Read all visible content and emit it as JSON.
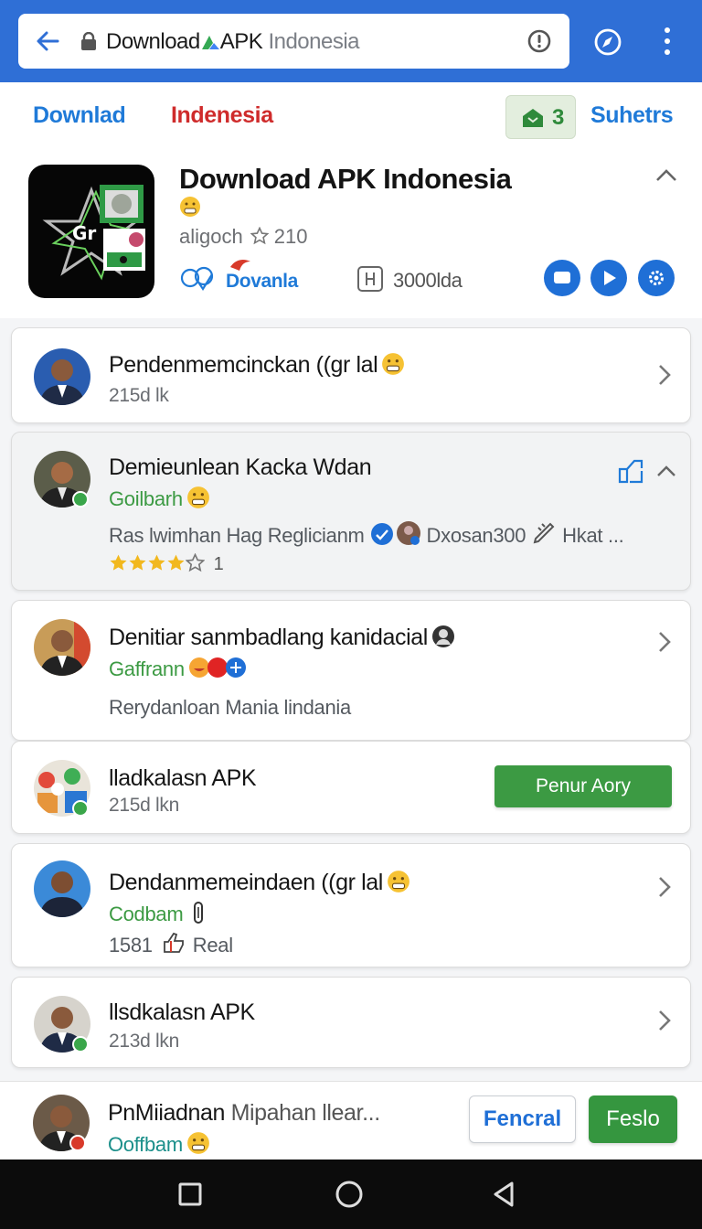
{
  "browser": {
    "url_brand": "Download",
    "url_brand_suffix": "APK",
    "url_rest": "Indonesia"
  },
  "header": {
    "download_link": "Downlad",
    "region_link": "Indenesia",
    "badge_count": "3",
    "subscribers_link": "Suhetrs"
  },
  "app": {
    "title": "Download APK Indonesia",
    "developer": "aligoch",
    "rating_count": "210",
    "download_label": "Dovanla",
    "size": "3000lda",
    "icon_text": "Gr"
  },
  "items": [
    {
      "title": "Pendenmemcinckan ((gr lal",
      "subtitle": "215d lk"
    },
    {
      "title": "Demieunlean Kacka Wdan",
      "subtitle": "Goilbarh",
      "description": "Ras lwimhan Hag Reglicianm",
      "extra_user": "Dxosan300",
      "extra_tail": "Hkat ...",
      "rating_count": "1",
      "rating": 4
    },
    {
      "title": "Denitiar sanmbadlang kanidacial",
      "subtitle": "Gaffrann",
      "description": "Rerydanloan Mania lindania"
    },
    {
      "title": "lladkalasn APK",
      "subtitle": "215d lkn",
      "action_label": "Penur Aory"
    },
    {
      "title": "Dendanmemeindaen ((gr lal",
      "subtitle": "Codbam",
      "meta_number": "1581",
      "meta_label": "Real"
    },
    {
      "title": "llsdkalasn APK",
      "subtitle": "213d lkn"
    }
  ],
  "bottom_bar": {
    "title": "PnMiiadnan",
    "title_rest": "Mipahan llear...",
    "subtitle": "Ooffbam",
    "secondary_button": "Fencral",
    "primary_button": "Feslo"
  },
  "colors": {
    "browser_bar": "#2f6fd6",
    "link_blue": "#1f7ad8",
    "accent_red": "#cf2b2b",
    "accent_green": "#3c9a43"
  },
  "icons": [
    "back-arrow-icon",
    "lock-icon",
    "info-icon",
    "compass-icon",
    "more-vert-icon",
    "inbox-icon",
    "chevron-up-icon",
    "chevron-right-icon",
    "message-icon",
    "play-icon",
    "settings-icon",
    "edit-icon",
    "square-icon",
    "circle-icon",
    "triangle-back-icon"
  ]
}
